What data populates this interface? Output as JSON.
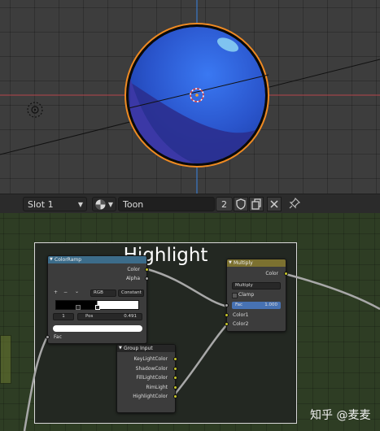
{
  "header": {
    "slot_label": "Slot 1",
    "material_name": "Toon",
    "user_count": "2"
  },
  "icons": {
    "slot_caret": "chevron-down-icon",
    "shader_ball": "material-sphere-icon",
    "fake_user": "shield-icon",
    "duplicate": "duplicate-icon",
    "unlink": "close-icon",
    "pin": "pin-icon",
    "object_origin": "origin-icon",
    "cursor_3d": "3d-cursor-icon"
  },
  "node_editor": {
    "frame_label": "Highlight",
    "colorramp": {
      "title": "ColorRamp",
      "outputs": [
        "Color",
        "Alpha"
      ],
      "add": "+",
      "remove": "−",
      "caret": "⌄",
      "mode": "RGB",
      "interpolation": "Constant",
      "stop_index": "1",
      "pos_label": "Pos",
      "pos_value": "0.491",
      "fac_label": "Fac"
    },
    "multiply": {
      "title": "Multiply",
      "output": "Color",
      "blend_mode": "Multiply",
      "clamp_label": "Clamp",
      "fac_label": "Fac",
      "fac_value": "1.000",
      "inputs": [
        "Color1",
        "Color2"
      ]
    },
    "group_input": {
      "title": "Group Input",
      "outputs": [
        "KeyLightColor",
        "ShadowColor",
        "FillLightColor",
        "RimLight",
        "HighlightColor"
      ]
    }
  },
  "watermark": "知乎 @麦麦",
  "colors": {
    "sphere_blue": "#2d5fd6",
    "selection_orange": "#f08a24",
    "colorramp_header": "#3c6c8a",
    "mix_header": "#7c7130",
    "socket_yellow": "#c7c729",
    "socket_grey": "#a1a1a1"
  }
}
